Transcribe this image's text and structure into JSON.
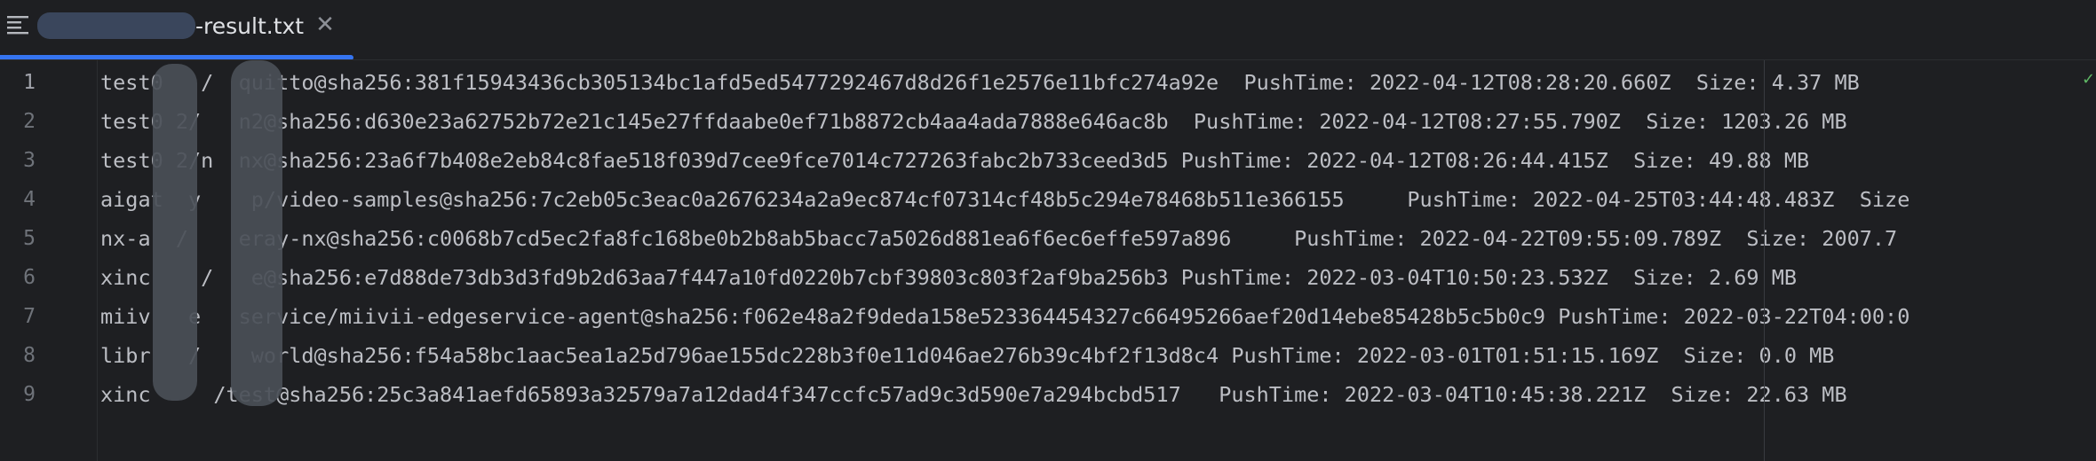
{
  "tab": {
    "title": "-result.txt",
    "icon": "structure-menu-icon",
    "close_icon": "close-icon"
  },
  "editor": {
    "line_numbers": [
      "1",
      "2",
      "3",
      "4",
      "5",
      "6",
      "7",
      "8",
      "9"
    ],
    "lines": [
      "test0   /  quitto@sha256:381f15943436cb305134bc1afd5ed5477292467d8d26f1e2576e11bfc274a92e  PushTime: 2022-04-12T08:28:20.660Z  Size: 4.37 MB",
      "test0 2/   n2@sha256:d630e23a62752b72e21c145e27ffdaabe0ef71b8872cb4aa4ada7888e646ac8b  PushTime: 2022-04-12T08:27:55.790Z  Size: 1203.26 MB",
      "test0 2/n  nx@sha256:23a6f7b408e2eb84c8fae518f039d7cee9fce7014c727263fabc2b733ceed3d5 PushTime: 2022-04-12T08:26:44.415Z  Size: 49.88 MB",
      "aigat  y    p/video-samples@sha256:7c2eb05c3eac0a2676234a2a9ec874cf07314cf48b5c294e78468b511e366155     PushTime: 2022-04-25T03:44:48.483Z  Size",
      "nx-a  /    eray-nx@sha256:c0068b7cd5ec2fa8fc168be0b2b8ab5bacc7a5026d881ea6f6ec6effe597a896     PushTime: 2022-04-22T09:55:09.789Z  Size: 2007.7",
      "xinc    /   e@sha256:e7d88de73db3d3fd9b2d63aa7f447a10fd0220b7cbf39803c803f2af9ba256b3 PushTime: 2022-03-04T10:50:23.532Z  Size: 2.69 MB",
      "miiv   e   service/miivii-edgeservice-agent@sha256:f062e48a2f9deda158e523364454327c66495266aef20d14ebe85428b5c5b0c9 PushTime: 2022-03-22T04:00:0",
      "libr   /    world@sha256:f54a58bc1aac5ea1a25d796ae155dc228b3f0e11d046ae276b39c4bf2f13d8c4 PushTime: 2022-03-01T01:51:15.169Z  Size: 0.0 MB",
      "xinc     /test@sha256:25c3a841aefd65893a32579a7a12dad4f347ccfc57ad9c3d590e7a294bcbd517   PushTime: 2022-03-04T10:45:38.221Z  Size: 22.63 MB"
    ]
  },
  "colors": {
    "background": "#1e1f22",
    "text": "#bcbec4",
    "line_number": "#6f737a",
    "accent": "#3574f0"
  }
}
